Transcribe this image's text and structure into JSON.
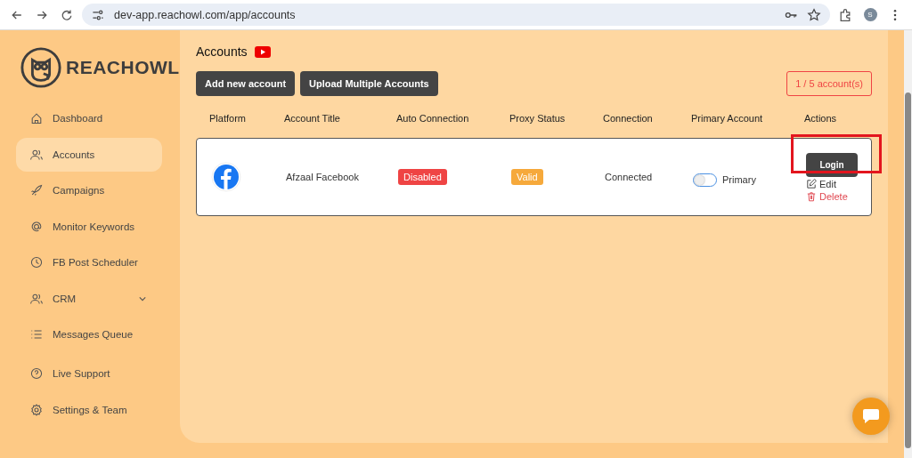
{
  "browser": {
    "url": "dev-app.reachowl.com/app/accounts",
    "profile": "S"
  },
  "sidebar": {
    "logo": "REACHOWL",
    "items": [
      {
        "label": "Dashboard",
        "selected": false
      },
      {
        "label": "Accounts",
        "selected": true
      },
      {
        "label": "Campaigns",
        "selected": false
      },
      {
        "label": "Monitor Keywords",
        "selected": false
      },
      {
        "label": "FB Post Scheduler",
        "selected": false
      },
      {
        "label": "CRM",
        "selected": false,
        "expandable": true
      },
      {
        "label": "Messages Queue",
        "selected": false
      },
      {
        "label": "Live Support",
        "selected": false
      },
      {
        "label": "Settings & Team",
        "selected": false
      }
    ]
  },
  "page": {
    "title": "Accounts",
    "buttons": [
      "Add new account",
      "Upload Multiple Accounts"
    ],
    "count": "1 / 5 account(s)"
  },
  "table": {
    "columns": [
      "Platform",
      "Account Title",
      "Auto Connection",
      "Proxy Status",
      "Connection",
      "Primary Account",
      "Actions"
    ],
    "rows": [
      {
        "title": "Afzaal Facebook",
        "auto_connection": {
          "label": "Disabled",
          "color": "#ef4444"
        },
        "proxy_status": {
          "label": "Valid",
          "color": "#f6a93b"
        },
        "connection": "Connected",
        "primary": {
          "label": "Primary",
          "on": false
        },
        "actions": {
          "login": "Login",
          "edit": "Edit",
          "delete": "Delete",
          "highlighted": true
        }
      }
    ]
  }
}
